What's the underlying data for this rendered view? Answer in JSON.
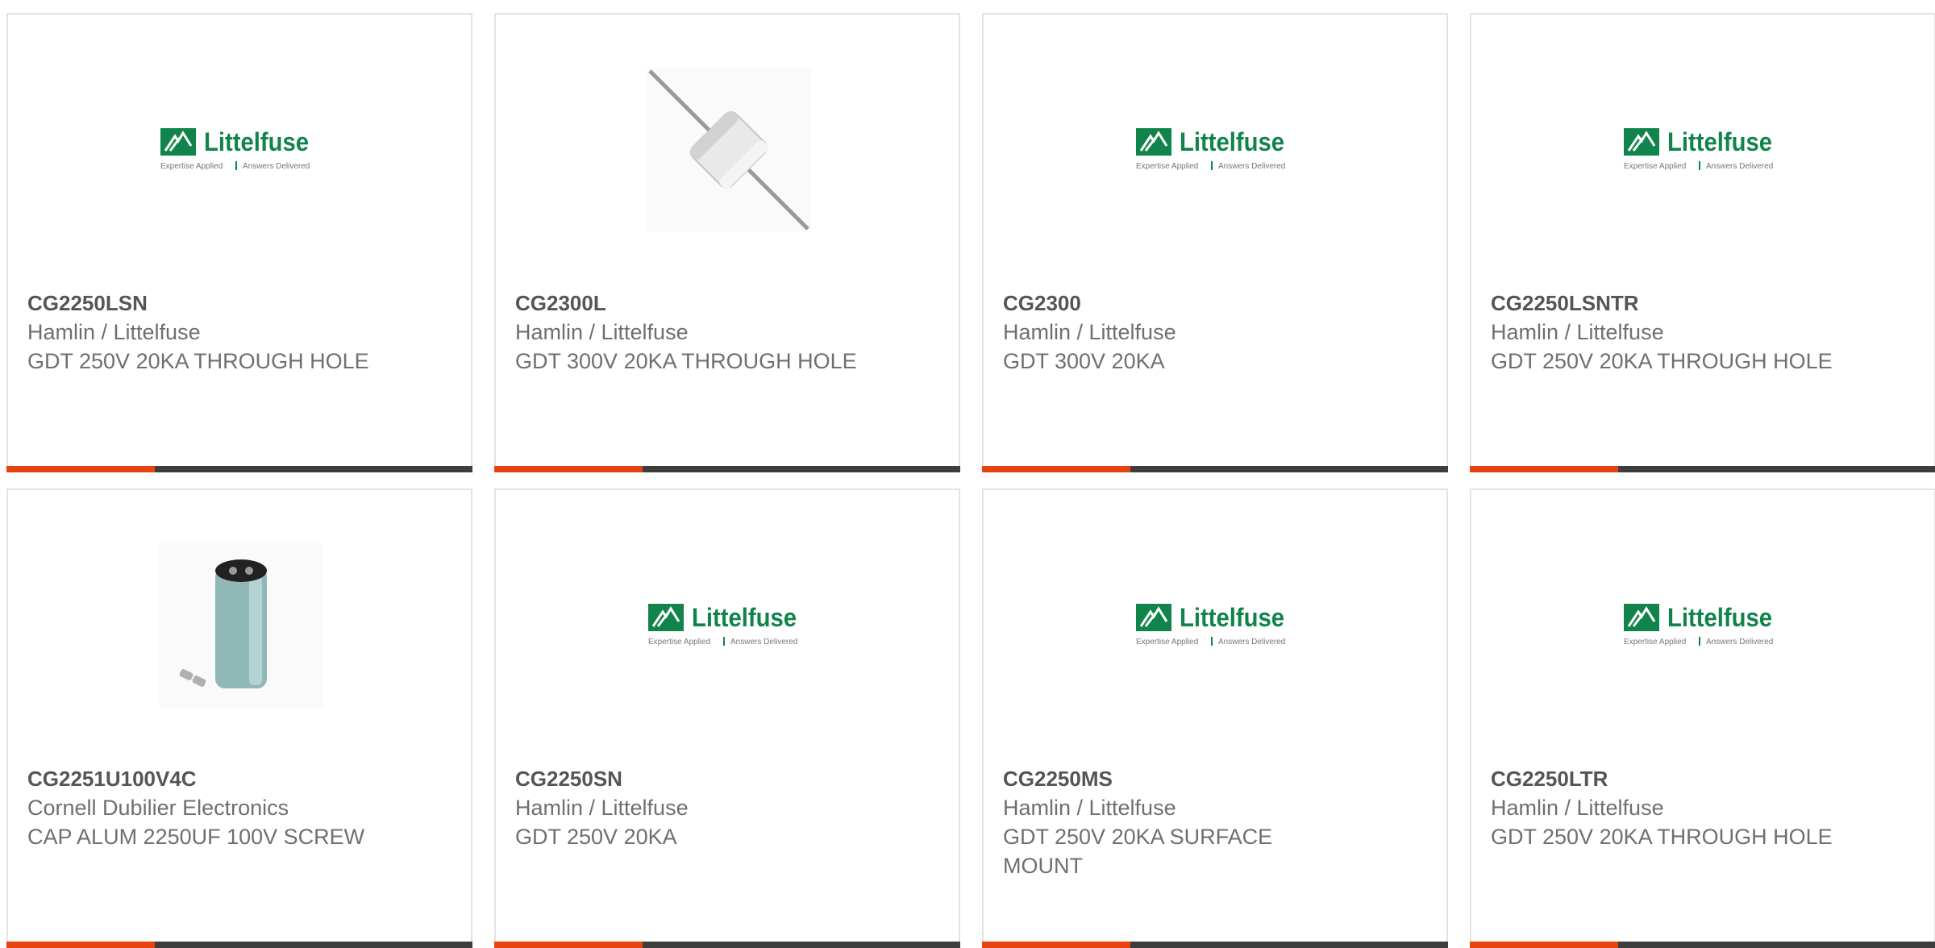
{
  "colors": {
    "brand_green": "#10844a",
    "accent_orange": "#e8420f",
    "bar_dark": "#3d3d3d",
    "title_text": "#555555",
    "body_text": "#6f6f6f"
  },
  "logo": {
    "brand": "Littelfuse",
    "tagline_left": "Expertise Applied",
    "tagline_right": "Answers Delivered"
  },
  "products": [
    {
      "part_number": "CG2250LSN",
      "manufacturer": "Hamlin / Littelfuse",
      "description": "GDT 250V 20KA THROUGH HOLE",
      "image": "littelfuse-logo"
    },
    {
      "part_number": "CG2300L",
      "manufacturer": "Hamlin / Littelfuse",
      "description": "GDT 300V 20KA THROUGH HOLE",
      "image": "gas-discharge-tube-photo"
    },
    {
      "part_number": "CG2300",
      "manufacturer": "Hamlin / Littelfuse",
      "description": "GDT 300V 20KA",
      "image": "littelfuse-logo"
    },
    {
      "part_number": "CG2250LSNTR",
      "manufacturer": "Hamlin / Littelfuse",
      "description": "GDT 250V 20KA THROUGH HOLE",
      "image": "littelfuse-logo"
    },
    {
      "part_number": "CG2251U100V4C",
      "manufacturer": "Cornell Dubilier Electronics",
      "description": "CAP ALUM 2250UF 100V SCREW",
      "image": "aluminum-capacitor-photo"
    },
    {
      "part_number": "CG2250SN",
      "manufacturer": "Hamlin / Littelfuse",
      "description": "GDT 250V 20KA",
      "image": "littelfuse-logo"
    },
    {
      "part_number": "CG2250MS",
      "manufacturer": "Hamlin / Littelfuse",
      "description": "GDT 250V 20KA SURFACE MOUNT",
      "image": "littelfuse-logo"
    },
    {
      "part_number": "CG2250LTR",
      "manufacturer": "Hamlin / Littelfuse",
      "description": "GDT 250V 20KA THROUGH HOLE",
      "image": "littelfuse-logo"
    }
  ]
}
